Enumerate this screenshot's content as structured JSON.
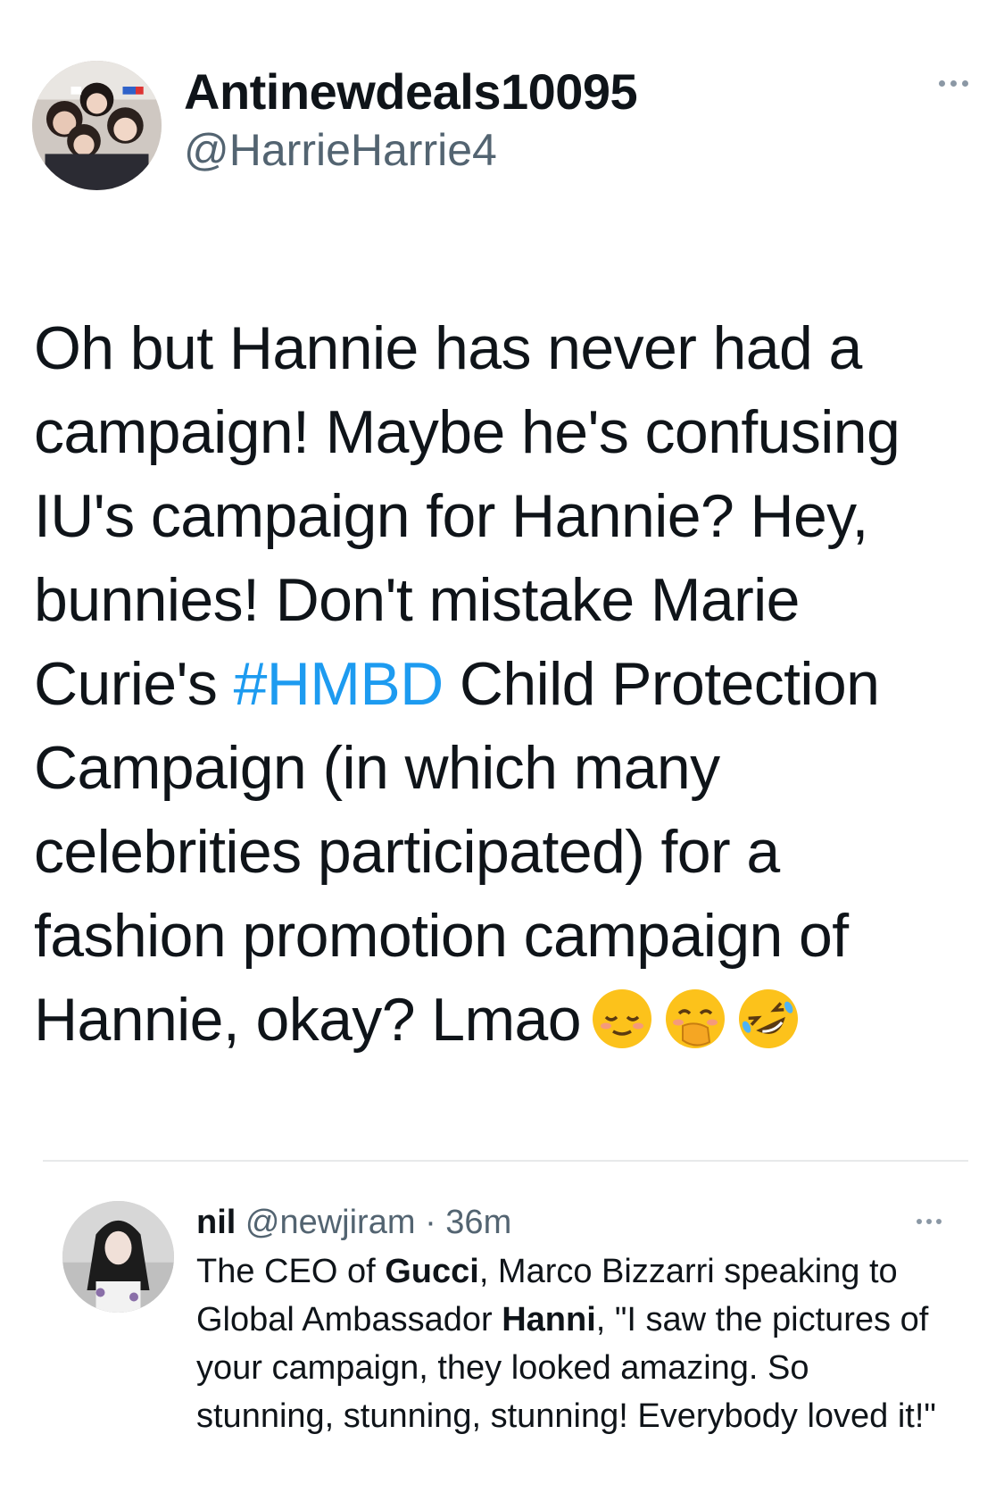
{
  "tweet": {
    "display_name": "Antinewdeals10095",
    "handle": "@HarrieHarrie4",
    "avatar_icon": "user-avatar-group-photo",
    "more_icon": "more-options-icon",
    "text_before_hashtag": "Oh but Hannie has never had a campaign! Maybe he's confusing IU's campaign for Hannie? Hey, bunnies! Don't mistake Marie Curie's ",
    "hashtag": "#HMBD",
    "text_after_hashtag": " Child Protection Campaign (in which many celebrities participated) for a fashion promotion campaign of Hannie, okay? Lmao",
    "emojis": [
      "relieved-face",
      "face-with-hand-over-mouth",
      "rolling-on-floor-laughing"
    ],
    "hashtag_color": "#1d9bf0"
  },
  "quoted": {
    "name": "nil",
    "handle": "@newjiram",
    "separator": "·",
    "time": "36m",
    "text_parts": [
      {
        "t": "The CEO of ",
        "bold": false
      },
      {
        "t": "Gucci",
        "bold": true
      },
      {
        "t": ", Marco Bizzarri speaking to Global Ambassador ",
        "bold": false
      },
      {
        "t": "Hanni",
        "bold": true
      },
      {
        "t": ", \"I saw the pictures of your campaign, they looked amazing. So stunning, stunning, stunning! Everybody loved it!\"",
        "bold": false
      }
    ]
  }
}
